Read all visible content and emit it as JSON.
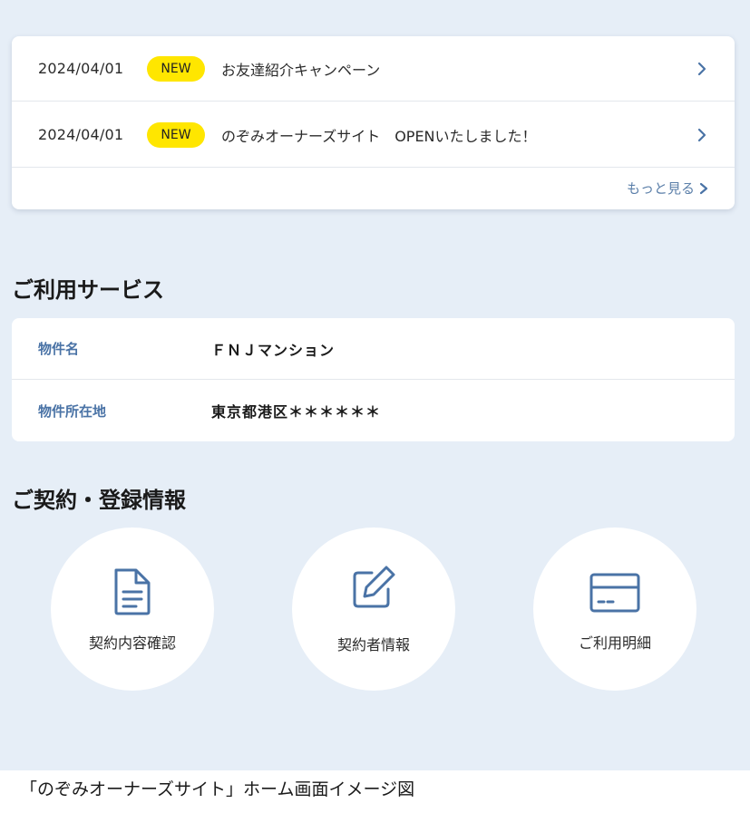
{
  "news": {
    "items": [
      {
        "date": "2024/04/01",
        "badge": "NEW",
        "title": "お友達紹介キャンペーン"
      },
      {
        "date": "2024/04/01",
        "badge": "NEW",
        "title": "のぞみオーナーズサイト　OPENいたしました！"
      }
    ],
    "more_label": "もっと見る"
  },
  "services": {
    "heading": "ご利用サービス",
    "rows": [
      {
        "label": "物件名",
        "value": "ＦＮＪマンション"
      },
      {
        "label": "物件所在地",
        "value": "東京都港区＊＊＊＊＊＊"
      }
    ]
  },
  "contract": {
    "heading": "ご契約・登録情報",
    "buttons": [
      {
        "label": "契約内容確認",
        "icon": "document-icon"
      },
      {
        "label": "契約者情報",
        "icon": "edit-icon"
      },
      {
        "label": "ご利用明細",
        "icon": "credit-card-icon"
      }
    ]
  },
  "caption": "「のぞみオーナーズサイト」ホーム画面イメージ図",
  "colors": {
    "background": "#e6eef7",
    "accent": "#4a73a6",
    "badge": "#ffe600"
  }
}
